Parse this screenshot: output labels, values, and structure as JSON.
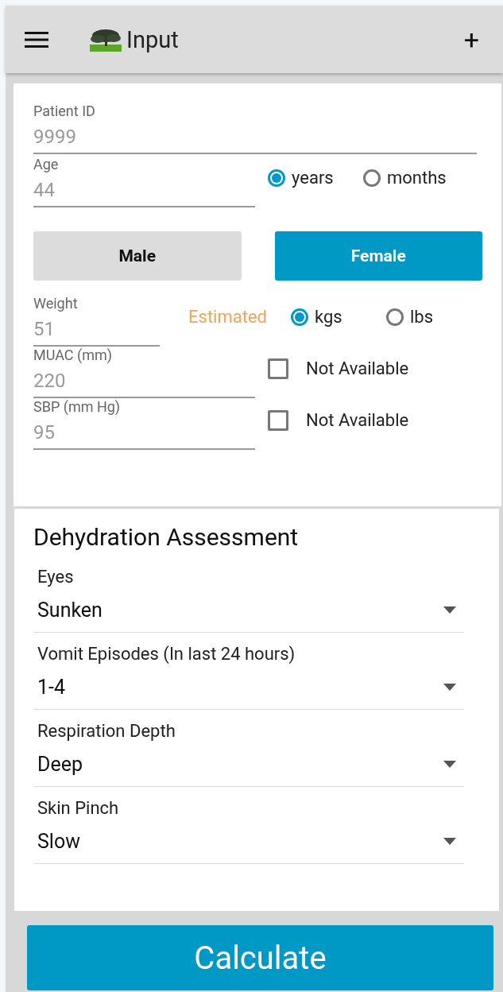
{
  "app_bar": {
    "title": "Input",
    "action": "+"
  },
  "patient": {
    "patient_id": {
      "label": "Patient ID",
      "value": "9999"
    },
    "age": {
      "label": "Age",
      "value": "44"
    },
    "age_units": [
      {
        "label": "years",
        "selected": true
      },
      {
        "label": "months",
        "selected": false
      }
    ],
    "sex": [
      {
        "label": "Male",
        "selected": false
      },
      {
        "label": "Female",
        "selected": true
      }
    ],
    "weight": {
      "label": "Weight",
      "value": "51",
      "badge": "Estimated"
    },
    "weight_units": [
      {
        "label": "kgs",
        "selected": true
      },
      {
        "label": "lbs",
        "selected": false
      }
    ],
    "muac": {
      "label": "MUAC (mm)",
      "value": "220",
      "not_available": {
        "label": "Not Available",
        "checked": false
      }
    },
    "sbp": {
      "label": "SBP (mm Hg)",
      "value": "95",
      "not_available": {
        "label": "Not Available",
        "checked": false
      }
    }
  },
  "dehydration": {
    "title": "Dehydration Assessment",
    "fields": [
      {
        "label": "Eyes",
        "value": "Sunken"
      },
      {
        "label": "Vomit Episodes (In last 24 hours)",
        "value": "1-4"
      },
      {
        "label": "Respiration Depth",
        "value": "Deep"
      },
      {
        "label": "Skin Pinch",
        "value": "Slow"
      }
    ]
  },
  "calculate_button": "Calculate"
}
